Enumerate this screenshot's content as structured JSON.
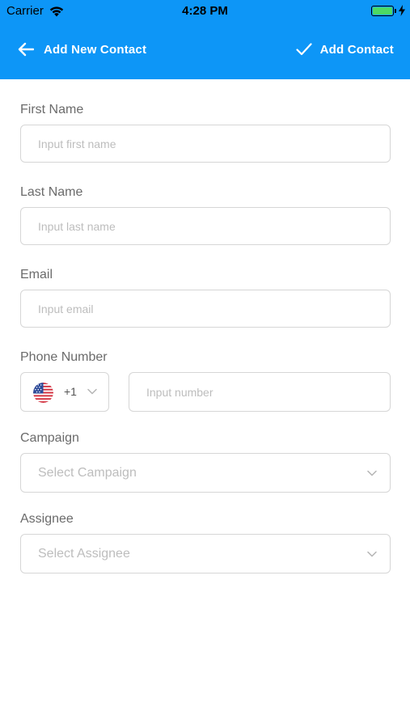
{
  "status_bar": {
    "carrier": "Carrier",
    "time": "4:28 PM",
    "battery_color": "#4cd964",
    "wifi_icon": "wifi-icon",
    "charging_icon": "bolt-icon"
  },
  "nav": {
    "title": "Add New Contact",
    "action_label": "Add Contact",
    "background": "#0d96f7",
    "back_icon": "arrow-left-icon",
    "action_icon": "checkmark-icon"
  },
  "form": {
    "first_name": {
      "label": "First Name",
      "placeholder": "Input first name",
      "value": ""
    },
    "last_name": {
      "label": "Last Name",
      "placeholder": "Input last name",
      "value": ""
    },
    "email": {
      "label": "Email",
      "placeholder": "Input email",
      "value": ""
    },
    "phone": {
      "label": "Phone Number",
      "country_code": "+1",
      "country_flag": "us-flag-icon",
      "placeholder": "Input number",
      "value": ""
    },
    "campaign": {
      "label": "Campaign",
      "placeholder": "Select Campaign"
    },
    "assignee": {
      "label": "Assignee",
      "placeholder": "Select Assignee"
    }
  }
}
